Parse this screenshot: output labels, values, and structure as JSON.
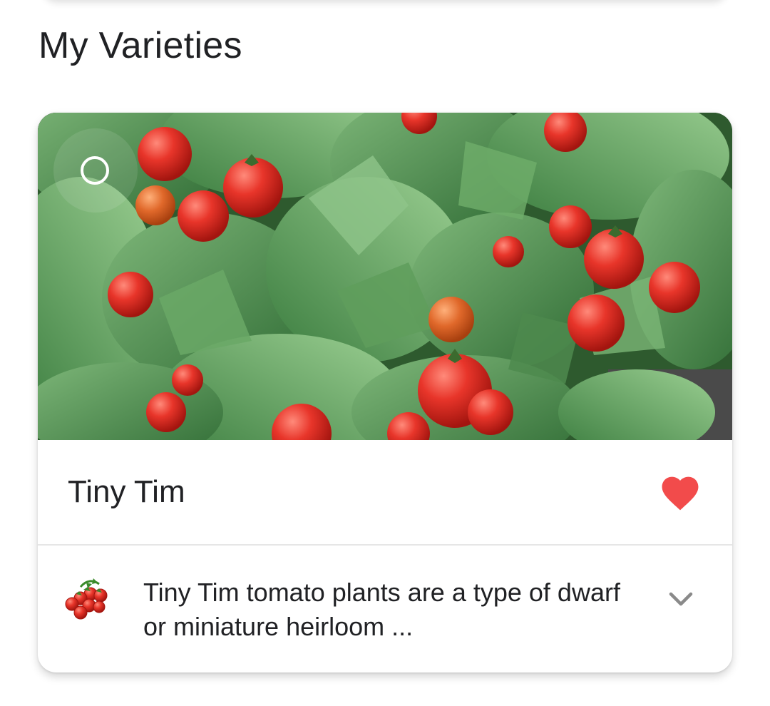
{
  "section": {
    "title": "My Varieties"
  },
  "variety": {
    "name": "Tiny Tim",
    "description": "Tiny Tim tomato plants are a type of dwarf or miniature heirloom ...",
    "favorite": true,
    "image_subject": "cherry tomato plant with red tomatoes and green leaves"
  },
  "icons": {
    "select": "radio-circle-icon",
    "favorite": "heart-icon",
    "variety_type": "tomato-icon",
    "expand": "chevron-down-icon"
  },
  "colors": {
    "favorite": "#f24b4b",
    "chevron": "#8a8a8a",
    "text": "#202124"
  }
}
